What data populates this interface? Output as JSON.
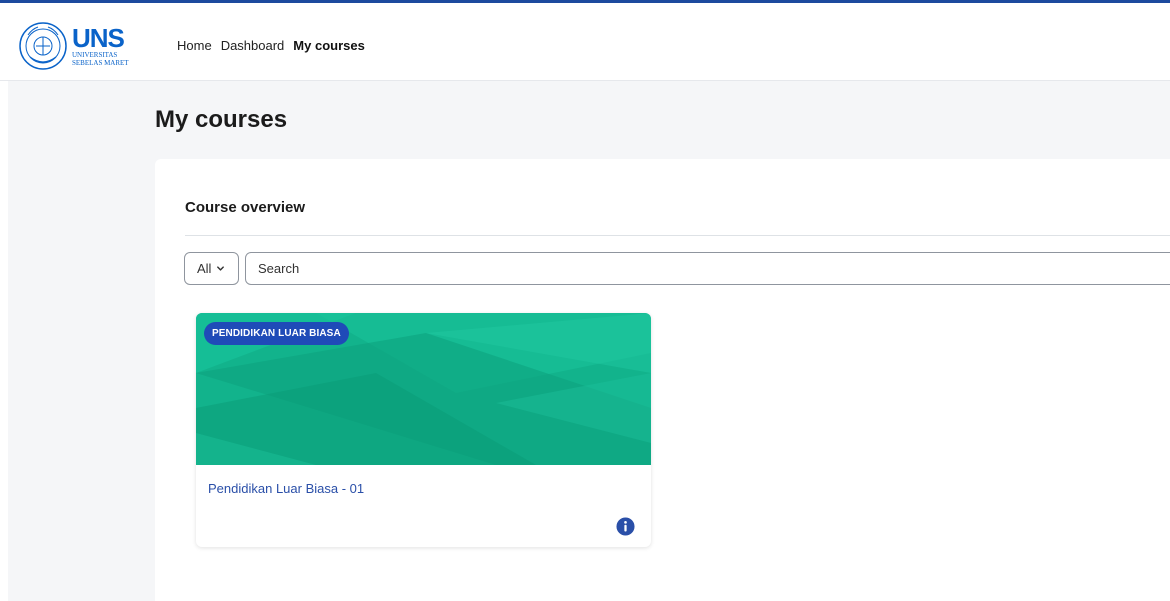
{
  "logo": {
    "title": "UNS",
    "subtitle_line1": "UNIVERSITAS",
    "subtitle_line2": "SEBELAS MARET",
    "icon": "university-seal-icon"
  },
  "nav": {
    "items": [
      {
        "label": "Home"
      },
      {
        "label": "Dashboard"
      },
      {
        "label": "My courses",
        "active": true
      }
    ]
  },
  "page": {
    "title": "My courses"
  },
  "overview": {
    "title": "Course overview",
    "filter": {
      "selected": "All",
      "icon": "chevron-down-icon"
    },
    "search": {
      "placeholder": "Search",
      "value": ""
    }
  },
  "courses": [
    {
      "category": "PENDIDIKAN LUAR BIASA",
      "name": "Pendidikan Luar Biasa - 01",
      "menu_icon": "info-icon"
    }
  ],
  "colors": {
    "accent": "#1d4a9e",
    "brand": "#0a63c9",
    "card_image": "#11b08a",
    "badge": "#1f4bb8",
    "link": "#2a4fa8"
  }
}
